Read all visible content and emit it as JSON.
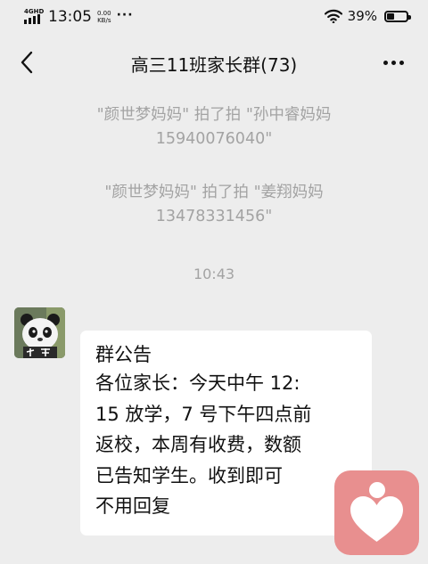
{
  "status_bar": {
    "network": "4GHD",
    "time": "13:05",
    "speed_value": "0.00",
    "speed_unit": "KB/s",
    "more_dots": "···",
    "battery_percent": "39%",
    "battery_level": 0.39
  },
  "header": {
    "title": "高三11班家长群(73)"
  },
  "messages": {
    "system_1": "\"颜世梦妈妈\" 拍了拍 \"孙中睿妈妈 15940076040\"",
    "system_2": "\"颜世梦妈妈\" 拍了拍 \"姜翔妈妈 13478331456\"",
    "timestamp": "10:43",
    "announcement": {
      "title": "群公告",
      "body": "各位家长：今天中午 12:\n15 放学，7 号下午四点前\n返校，本周有收费，数额\n已告知学生。收到即可\n不用回复"
    }
  },
  "icons": {
    "back": "chevron-left-icon",
    "more": "more-horizontal-icon",
    "wifi": "wifi-icon",
    "battery": "battery-icon",
    "signal": "signal-icon",
    "float": "heart-person-icon"
  },
  "colors": {
    "background": "#ededed",
    "bubble": "#ffffff",
    "system_text": "#a3a3a3",
    "float_widget": "#e88f8f"
  }
}
